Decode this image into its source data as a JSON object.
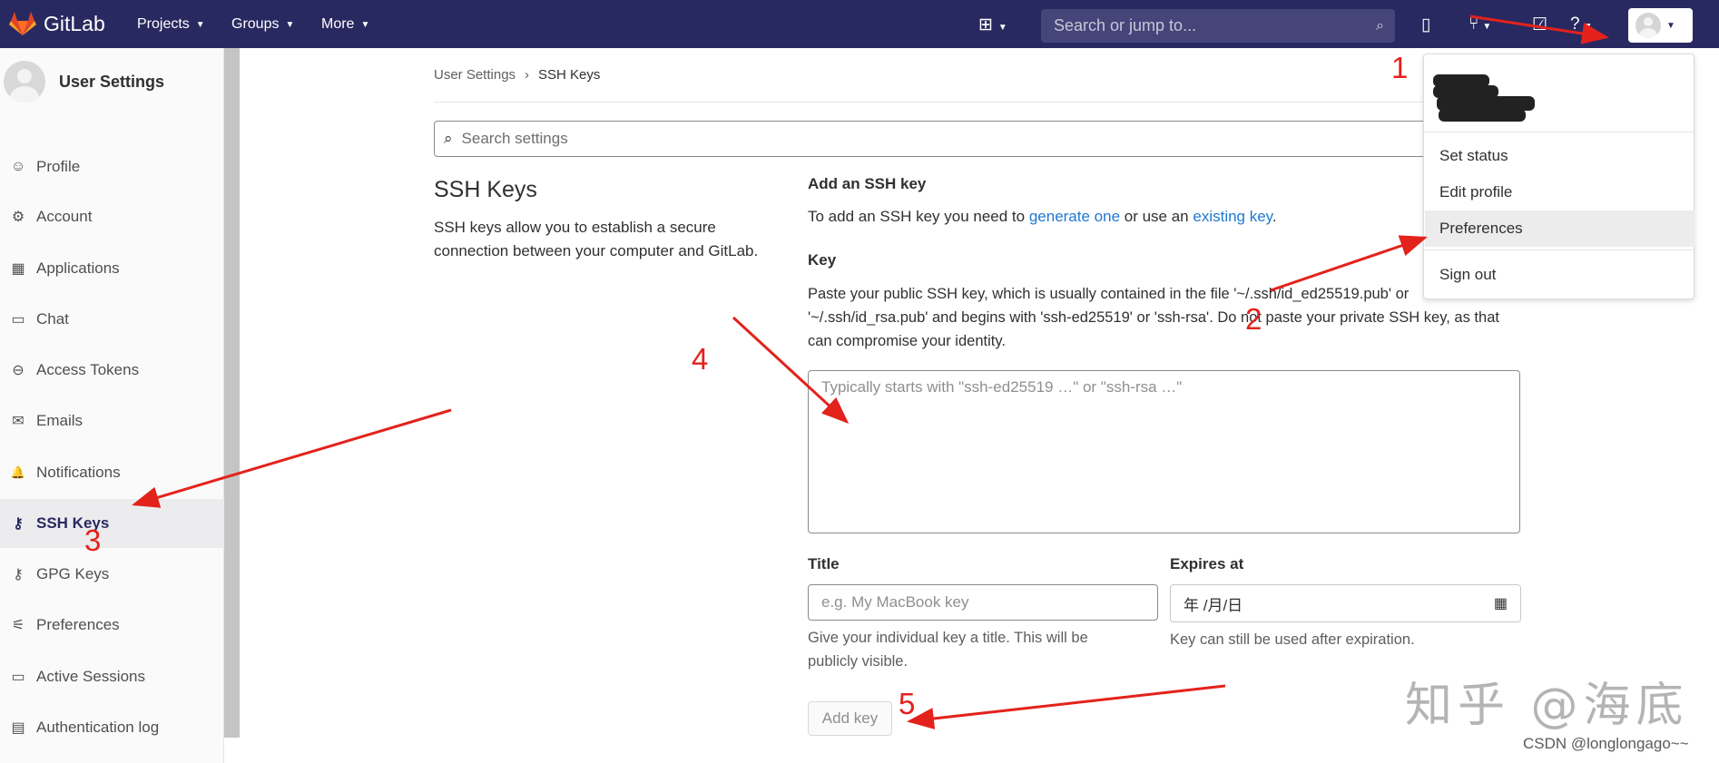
{
  "nav": {
    "brand": "GitLab",
    "projects": "Projects",
    "groups": "Groups",
    "more": "More",
    "search_placeholder": "Search or jump to...",
    "brand_color": "#292961"
  },
  "sidebar": {
    "title": "User Settings",
    "items": [
      {
        "label": "Profile",
        "icon": "profile-icon",
        "glyph": "☺"
      },
      {
        "label": "Account",
        "icon": "account-icon",
        "glyph": "⚙"
      },
      {
        "label": "Applications",
        "icon": "applications-icon",
        "glyph": "▦"
      },
      {
        "label": "Chat",
        "icon": "chat-icon",
        "glyph": "▭"
      },
      {
        "label": "Access Tokens",
        "icon": "token-icon",
        "glyph": "⊖"
      },
      {
        "label": "Emails",
        "icon": "mail-icon",
        "glyph": "✉"
      },
      {
        "label": "Notifications",
        "icon": "bell-icon",
        "glyph": "🔔"
      },
      {
        "label": "SSH Keys",
        "icon": "key-icon",
        "glyph": "⚷"
      },
      {
        "label": "GPG Keys",
        "icon": "key-icon",
        "glyph": "⚷"
      },
      {
        "label": "Preferences",
        "icon": "preferences-icon",
        "glyph": "⚟"
      },
      {
        "label": "Active Sessions",
        "icon": "monitor-icon",
        "glyph": "▭"
      },
      {
        "label": "Authentication log",
        "icon": "log-icon",
        "glyph": "▤"
      }
    ]
  },
  "breadcrumb": {
    "parent": "User Settings",
    "separator": "›",
    "current": "SSH Keys"
  },
  "settings_search_placeholder": "Search settings",
  "section": {
    "title": "SSH Keys",
    "description": "SSH keys allow you to establish a secure connection between your computer and GitLab."
  },
  "form": {
    "heading": "Add an SSH key",
    "intro_before": "To add an SSH key you need to ",
    "link_generate": "generate one",
    "intro_middle": " or use an ",
    "link_existing": "existing key",
    "intro_after": ".",
    "key_label": "Key",
    "key_help": "Paste your public SSH key, which is usually contained in the file '~/.ssh/id_ed25519.pub' or '~/.ssh/id_rsa.pub' and begins with 'ssh-ed25519' or 'ssh-rsa'. Do not paste your private SSH key, as that can compromise your identity.",
    "key_placeholder": "Typically starts with \"ssh-ed25519 …\" or \"ssh-rsa …\"",
    "title_label": "Title",
    "title_placeholder": "e.g. My MacBook key",
    "title_help": "Give your individual key a title. This will be publicly visible.",
    "expires_label": "Expires at",
    "expires_value": "年 /月/日",
    "expires_help": "Key can still be used after expiration.",
    "submit": "Add key"
  },
  "user_menu": {
    "items": [
      "Set status",
      "Edit profile",
      "Preferences",
      "Sign out"
    ],
    "highlighted": "Preferences"
  },
  "annotations": {
    "numbers": [
      "1",
      "2",
      "3",
      "4",
      "5"
    ],
    "arrow_color": "#e3221c"
  },
  "watermark": "知乎 @海底",
  "credit": "CSDN @longlongago~~"
}
